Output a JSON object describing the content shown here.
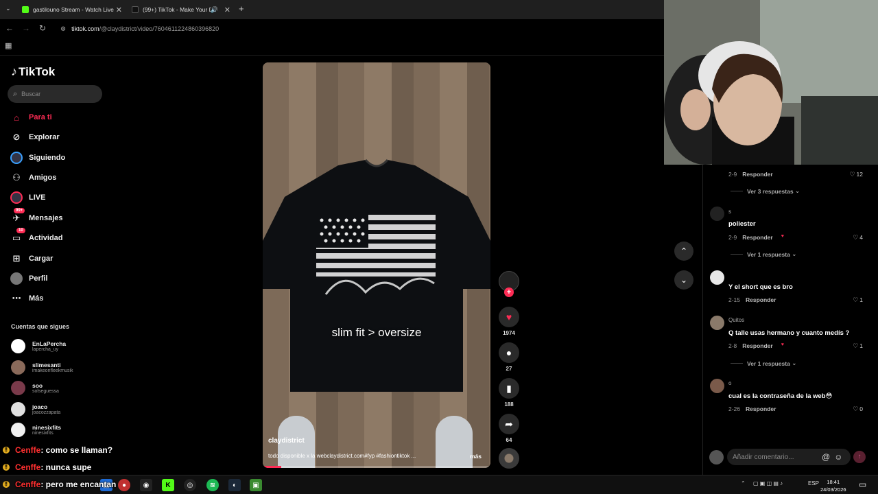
{
  "browser": {
    "tabs": [
      {
        "title": "gastilouno Stream - Watch Live",
        "icon_color": "#53fc18"
      },
      {
        "title": "(99+) TikTok - Make Your Da",
        "icon_color": "#111111"
      }
    ],
    "new_tab_icon": "plus-icon",
    "url_host": "tiktok.com",
    "url_path": "/@claydistrict/video/7604611224860396820"
  },
  "sidebar": {
    "logo": "TikTok",
    "search_placeholder": "Buscar",
    "nav": [
      {
        "label": "Para ti",
        "icon": "home-icon",
        "active": true
      },
      {
        "label": "Explorar",
        "icon": "compass-icon"
      },
      {
        "label": "Siguiendo",
        "icon": "following-icon"
      },
      {
        "label": "Amigos",
        "icon": "friends-icon"
      },
      {
        "label": "LIVE",
        "icon": "live-icon"
      },
      {
        "label": "Mensajes",
        "icon": "messages-icon",
        "badge": "99+"
      },
      {
        "label": "Actividad",
        "icon": "activity-icon",
        "badge": "10"
      },
      {
        "label": "Cargar",
        "icon": "upload-icon"
      },
      {
        "label": "Perfil",
        "icon": "profile-icon"
      },
      {
        "label": "Más",
        "icon": "more-icon"
      }
    ],
    "following_title": "Cuentas que sigues",
    "following": [
      {
        "name": "EnLaPercha",
        "user": "lapercha_uy",
        "color": "#ffffff"
      },
      {
        "name": "slimesanti",
        "user": "imakeonfleekmusik",
        "color": "#8a6a5a"
      },
      {
        "name": "soo",
        "user": "solseguessa",
        "color": "#7a3a4a"
      },
      {
        "name": "joaco",
        "user": "joacozzapata",
        "color": "#e0e0e0"
      },
      {
        "name": "ninesixfits",
        "user": "ninesixfits",
        "color": "#f0f0f0"
      }
    ]
  },
  "chat": [
    {
      "user": "Cenffe",
      "message": ": como se llaman?"
    },
    {
      "user": "Cenffe",
      "message": ": nunca supe"
    },
    {
      "user": "Cenffe",
      "message": ": pero me encantan"
    }
  ],
  "video": {
    "caption": "slim fit > oversize",
    "author": "claydistrict",
    "description": "todo disponible x la webclaydistrict.com#fyp #fashiontiktok ...",
    "more": "más",
    "progress": 0.08,
    "likes": "1974",
    "comments": "27",
    "saves": "188",
    "shares": "64"
  },
  "comments": {
    "items": [
      {
        "name": "",
        "text": "",
        "date": "2-9",
        "reply": "Responder",
        "likes": "12",
        "replies": "Ver 3 respuestas",
        "color": "#333333"
      },
      {
        "name": "s",
        "text": "poliester",
        "date": "2-9",
        "reply": "Responder",
        "likes": "4",
        "replies": "Ver 1 respuesta",
        "color": "#222222"
      },
      {
        "name": "",
        "text": "Y el short que es bro",
        "date": "2-15",
        "reply": "Responder",
        "likes": "1",
        "replies": "",
        "color": "#e8e8e8"
      },
      {
        "name": "Quitos",
        "text": "Q talle usas hermano y cuanto medís ?",
        "date": "2-8",
        "reply": "Responder",
        "likes": "1",
        "replies": "Ver 1 respuesta",
        "color": "#8a7a6a"
      },
      {
        "name": "o",
        "text": "cual es la contraseña de la web😳",
        "date": "2-26",
        "reply": "Responder",
        "likes": "0",
        "replies": "",
        "color": "#7a5a4a"
      }
    ],
    "input_placeholder": "Añadir comentario..."
  },
  "taskbar": {
    "language": "ESP",
    "time": "18:41",
    "date": "24/03/2026",
    "notifications": "5"
  }
}
